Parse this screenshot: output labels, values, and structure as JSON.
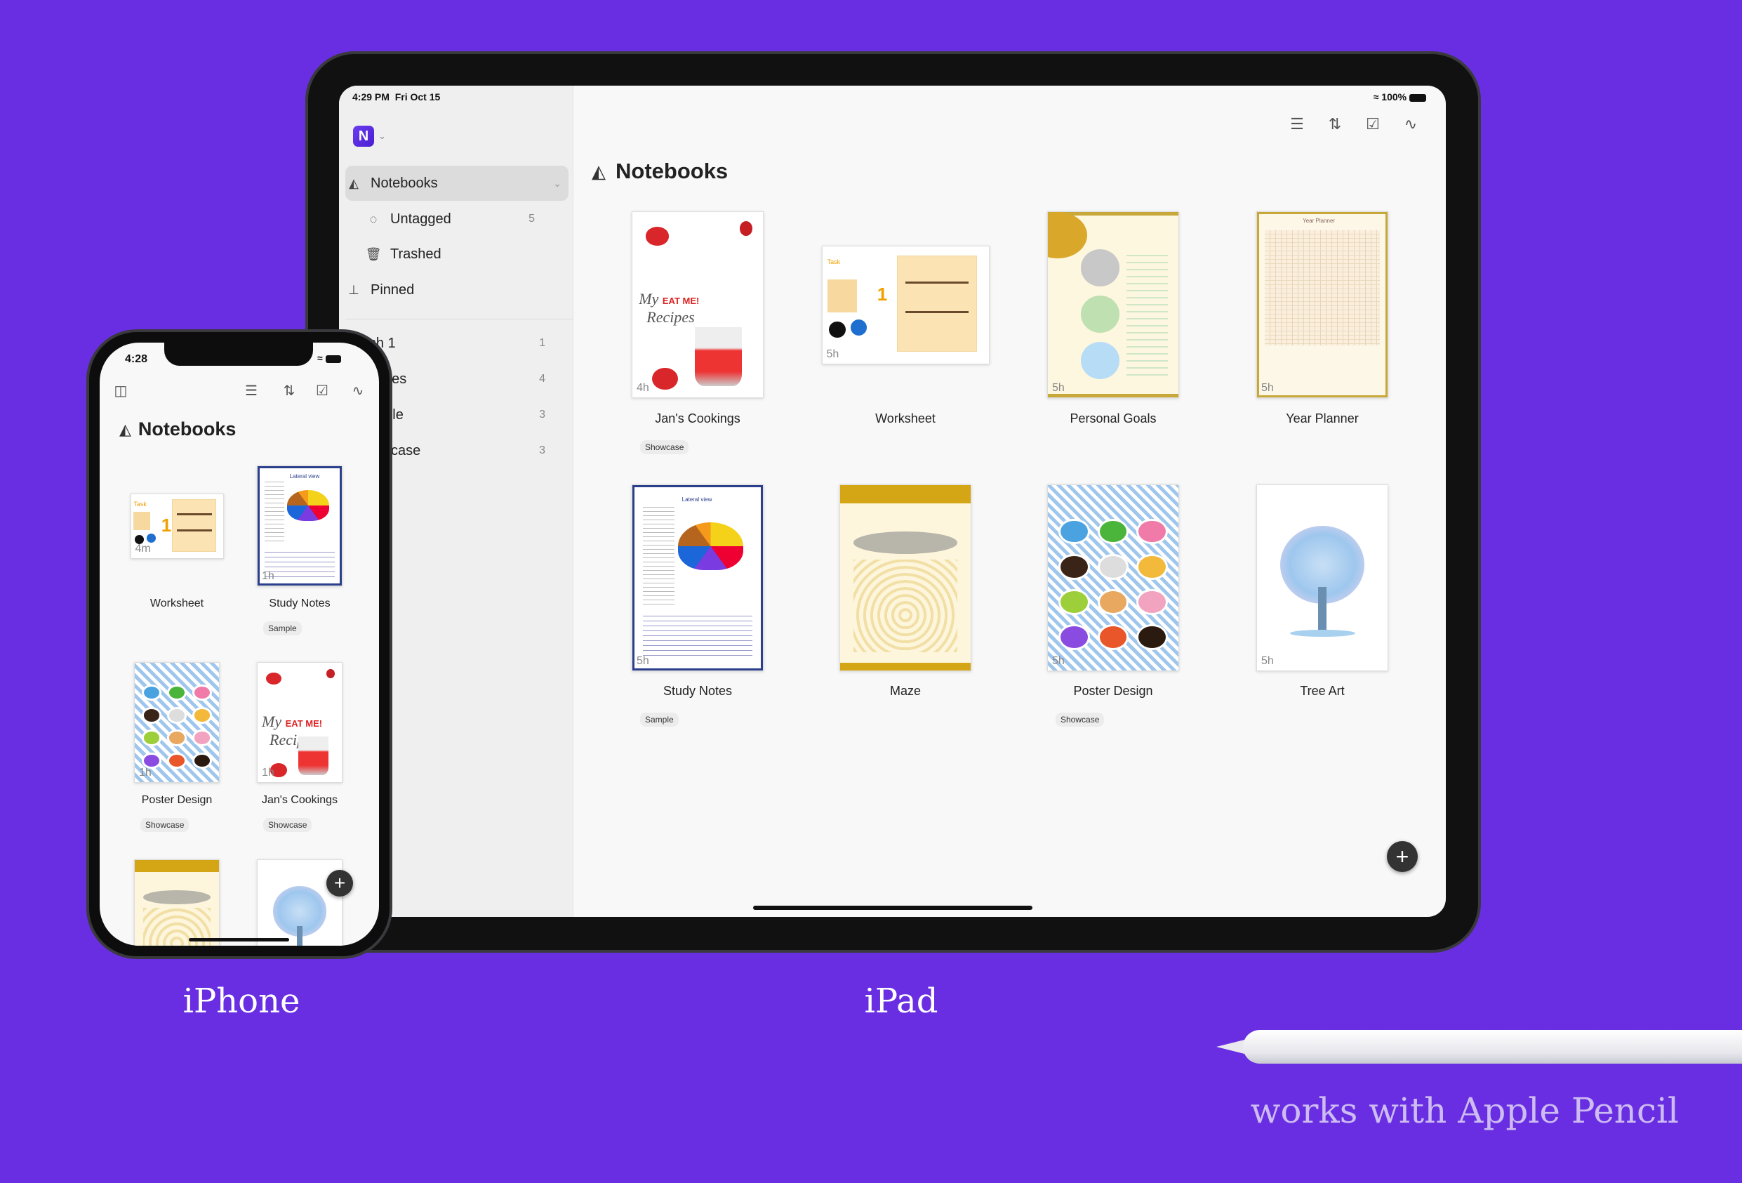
{
  "ipad": {
    "status": {
      "time": "4:29 PM",
      "date": "Fri Oct 15",
      "battery": "100%"
    },
    "sidebar": {
      "logo_letter": "N",
      "items": [
        {
          "label": "Notebooks",
          "icon": "tray-icon",
          "selected": true
        },
        {
          "label": "Untagged",
          "icon": "dashed-circle-icon",
          "count": "5"
        },
        {
          "label": "Trashed",
          "icon": "trash-icon"
        },
        {
          "label": "Pinned",
          "icon": "pin-icon"
        }
      ],
      "tags": [
        {
          "label": "Dish 1",
          "count": "1"
        },
        {
          "label": "Recipes",
          "count": "4"
        },
        {
          "label": "Sample",
          "count": "3"
        },
        {
          "label": "Showcase",
          "count": "3"
        }
      ]
    },
    "toolbar": [
      "list-icon",
      "sort-icon",
      "select-checkbox-icon",
      "scribble-icon"
    ],
    "title": "Notebooks",
    "notebooks": [
      {
        "title": "Jan's Cookings",
        "age": "4h",
        "badge": "Showcase",
        "thumb": "recipes"
      },
      {
        "title": "Worksheet",
        "age": "5h",
        "thumb": "worksheet"
      },
      {
        "title": "Personal Goals",
        "age": "5h",
        "thumb": "goals"
      },
      {
        "title": "Year Planner",
        "age": "5h",
        "thumb": "planner"
      },
      {
        "title": "Study Notes",
        "age": "5h",
        "badge": "Sample",
        "thumb": "study"
      },
      {
        "title": "Maze",
        "thumb": "maze"
      },
      {
        "title": "Poster Design",
        "age": "5h",
        "badge": "Showcase",
        "thumb": "poster"
      },
      {
        "title": "Tree Art",
        "age": "5h",
        "thumb": "tree"
      }
    ]
  },
  "iphone": {
    "status": {
      "time": "4:28"
    },
    "toolbar": [
      "sidebar-icon",
      "list-icon",
      "sort-icon",
      "select-checkbox-icon",
      "scribble-icon"
    ],
    "title": "Notebooks",
    "notebooks": [
      {
        "title": "Worksheet",
        "age": "4m",
        "thumb": "worksheet"
      },
      {
        "title": "Study Notes",
        "age": "1h",
        "badge": "Sample",
        "thumb": "study"
      },
      {
        "title": "Poster Design",
        "age": "1h",
        "badge": "Showcase",
        "thumb": "poster"
      },
      {
        "title": "Jan's Cookings",
        "age": "1h",
        "badge": "Showcase",
        "thumb": "recipes"
      },
      {
        "title": "",
        "thumb": "maze"
      },
      {
        "title": "",
        "thumb": "tree"
      }
    ]
  },
  "captions": {
    "iphone": "iPhone",
    "ipad": "iPad",
    "pencil": "works with Apple Pencil"
  },
  "colors": {
    "background": "#6a2ee2",
    "accent": "#5b2be0"
  }
}
